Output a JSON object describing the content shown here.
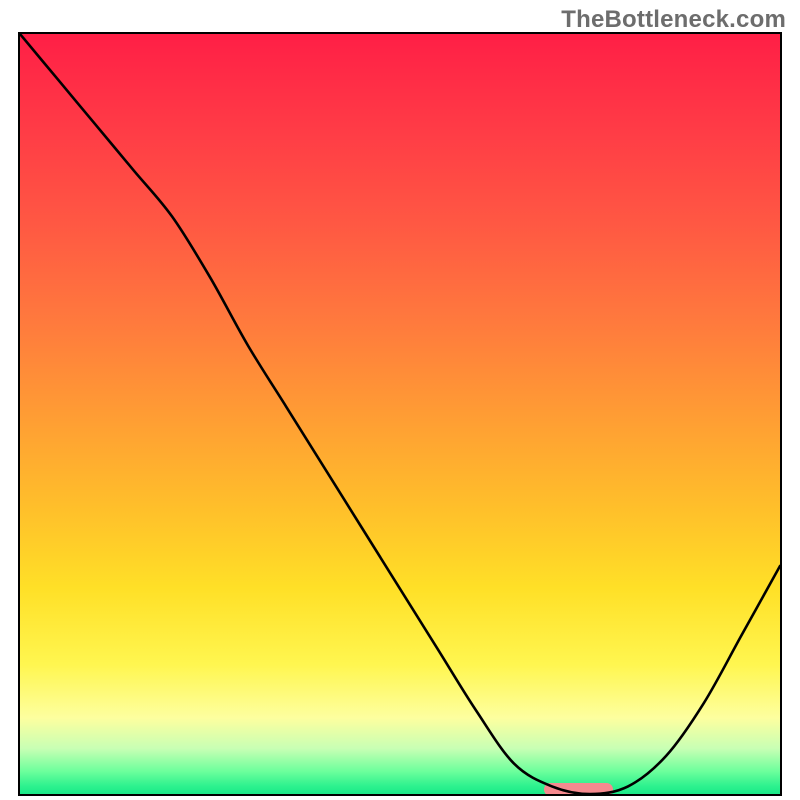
{
  "branding": {
    "watermark": "TheBottleneck.com"
  },
  "colors": {
    "line": "#000000",
    "marker": "#f58a8f",
    "border": "#000000",
    "gradient_stops": [
      "#ff1f46",
      "#ff3a46",
      "#ff5843",
      "#ff7a3d",
      "#ff9c34",
      "#ffc12a",
      "#ffe027",
      "#fff650",
      "#fdff9f",
      "#c8ffb4",
      "#6dff9c",
      "#2cf18e",
      "#1be988"
    ]
  },
  "chart_data": {
    "type": "line",
    "title": "",
    "xlabel": "",
    "ylabel": "",
    "xlim": [
      0,
      100
    ],
    "ylim": [
      0,
      100
    ],
    "x": [
      0,
      5,
      10,
      15,
      20,
      25,
      30,
      35,
      40,
      45,
      50,
      55,
      60,
      65,
      70,
      75,
      80,
      85,
      90,
      95,
      100
    ],
    "values": [
      100,
      94,
      88,
      82,
      76,
      68,
      59,
      51,
      43,
      35,
      27,
      19,
      11,
      4,
      1,
      0,
      1,
      5,
      12,
      21,
      30
    ],
    "notch": {
      "x_start": 69,
      "x_end": 78,
      "y": 0.6
    },
    "note": "Values are percentage heights estimated from the rendered curve (0 = bottom, 100 = top). X is percent across the plot area."
  }
}
